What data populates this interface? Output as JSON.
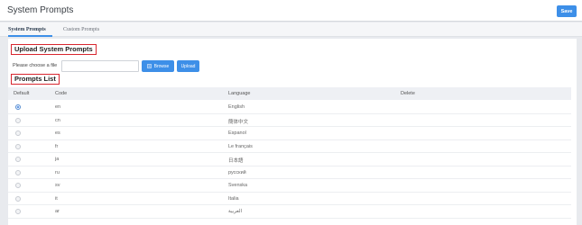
{
  "header": {
    "title": "System Prompts",
    "save_label": "Save"
  },
  "tabs": [
    {
      "label": "System Prompts",
      "active": true
    },
    {
      "label": "Custom Prompts",
      "active": false
    }
  ],
  "upload": {
    "title": "Upload System Prompts",
    "file_label": "Please choose a file",
    "file_value": "",
    "browse_label": "Browse",
    "browse_icon": "file-icon",
    "upload_label": "Upload"
  },
  "prompts_list": {
    "title": "Prompts List",
    "columns": [
      "Default",
      "Code",
      "Language",
      "Delete"
    ],
    "rows": [
      {
        "default": true,
        "code": "en",
        "language": "English"
      },
      {
        "default": false,
        "code": "cn",
        "language": "簡体中文"
      },
      {
        "default": false,
        "code": "es",
        "language": "Espanol"
      },
      {
        "default": false,
        "code": "fr",
        "language": "Le français"
      },
      {
        "default": false,
        "code": "ja",
        "language": "日本語"
      },
      {
        "default": false,
        "code": "ru",
        "language": "русский"
      },
      {
        "default": false,
        "code": "sv",
        "language": "Svenska"
      },
      {
        "default": false,
        "code": "it",
        "language": "Italia"
      },
      {
        "default": false,
        "code": "ar",
        "language": "العربية"
      }
    ]
  },
  "colors": {
    "accent": "#3d8fe8",
    "highlight_border": "#d8262f"
  }
}
